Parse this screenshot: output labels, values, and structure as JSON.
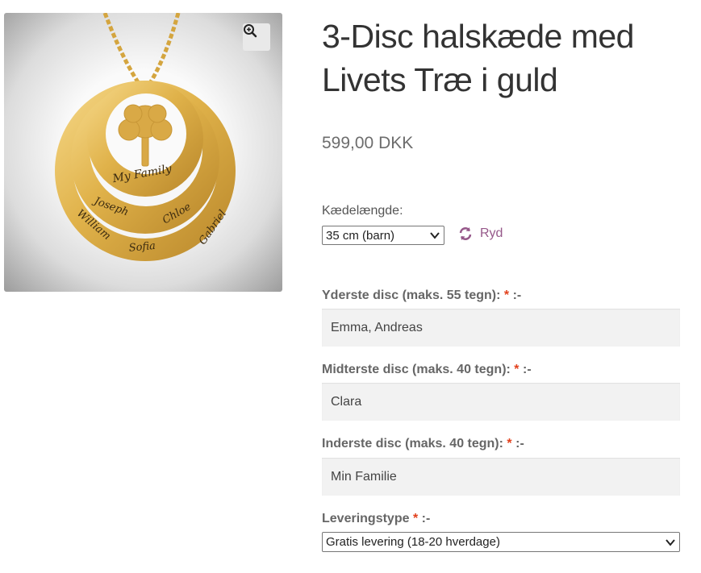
{
  "product": {
    "title_line1": "3-Disc halskæde med",
    "title_line2": "Livets Træ i guld",
    "price": "599,00 DKK",
    "image": {
      "engraving_inner": "My Family",
      "engraving_middle_left": "Joseph",
      "engraving_middle_right": "Chloe",
      "engraving_outer_left": "William",
      "engraving_outer_center": "Sofia",
      "engraving_outer_right": "Gabriel"
    }
  },
  "icons": {
    "zoom": "magnifier-plus-icon",
    "reset": "refresh-icon",
    "select_arrow": "chevron-down-icon"
  },
  "colors": {
    "accent": "#96588a",
    "required": "#e2401c",
    "gold": "#e0b24a"
  },
  "variation": {
    "label": "Kædelængde:",
    "selected": "35 cm (barn)",
    "reset_label": "Ryd"
  },
  "fields": [
    {
      "label": "Yderste disc (maks. 55 tegn):",
      "required_mark": "*",
      "suffix": ":-",
      "value": "Emma, Andreas"
    },
    {
      "label": "Midterste disc (maks. 40 tegn):",
      "required_mark": "*",
      "suffix": ":-",
      "value": "Clara"
    },
    {
      "label": "Inderste disc (maks. 40 tegn):",
      "required_mark": "*",
      "suffix": ":-",
      "value": "Min Familie"
    }
  ],
  "shipping": {
    "label": "Leveringstype",
    "required_mark": "*",
    "suffix": ":-",
    "selected": "Gratis levering (18-20 hverdage)"
  }
}
